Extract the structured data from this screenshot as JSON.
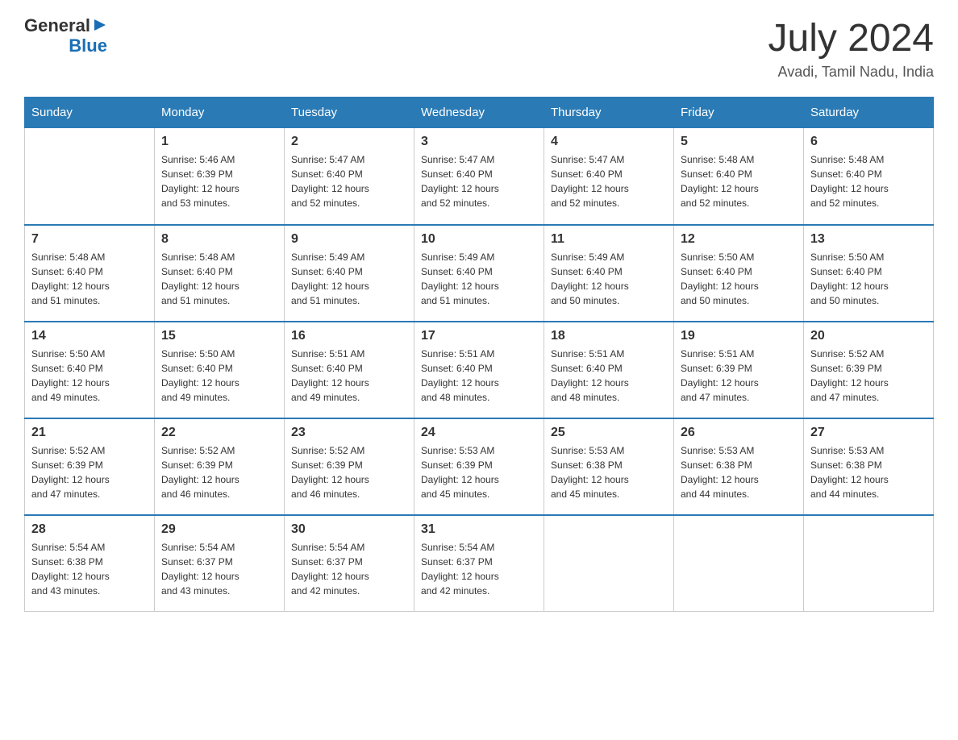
{
  "header": {
    "logo_text": "General",
    "logo_blue": "Blue",
    "month_year": "July 2024",
    "location": "Avadi, Tamil Nadu, India"
  },
  "columns": [
    "Sunday",
    "Monday",
    "Tuesday",
    "Wednesday",
    "Thursday",
    "Friday",
    "Saturday"
  ],
  "weeks": [
    [
      {
        "day": "",
        "info": ""
      },
      {
        "day": "1",
        "info": "Sunrise: 5:46 AM\nSunset: 6:39 PM\nDaylight: 12 hours\nand 53 minutes."
      },
      {
        "day": "2",
        "info": "Sunrise: 5:47 AM\nSunset: 6:40 PM\nDaylight: 12 hours\nand 52 minutes."
      },
      {
        "day": "3",
        "info": "Sunrise: 5:47 AM\nSunset: 6:40 PM\nDaylight: 12 hours\nand 52 minutes."
      },
      {
        "day": "4",
        "info": "Sunrise: 5:47 AM\nSunset: 6:40 PM\nDaylight: 12 hours\nand 52 minutes."
      },
      {
        "day": "5",
        "info": "Sunrise: 5:48 AM\nSunset: 6:40 PM\nDaylight: 12 hours\nand 52 minutes."
      },
      {
        "day": "6",
        "info": "Sunrise: 5:48 AM\nSunset: 6:40 PM\nDaylight: 12 hours\nand 52 minutes."
      }
    ],
    [
      {
        "day": "7",
        "info": "Sunrise: 5:48 AM\nSunset: 6:40 PM\nDaylight: 12 hours\nand 51 minutes."
      },
      {
        "day": "8",
        "info": "Sunrise: 5:48 AM\nSunset: 6:40 PM\nDaylight: 12 hours\nand 51 minutes."
      },
      {
        "day": "9",
        "info": "Sunrise: 5:49 AM\nSunset: 6:40 PM\nDaylight: 12 hours\nand 51 minutes."
      },
      {
        "day": "10",
        "info": "Sunrise: 5:49 AM\nSunset: 6:40 PM\nDaylight: 12 hours\nand 51 minutes."
      },
      {
        "day": "11",
        "info": "Sunrise: 5:49 AM\nSunset: 6:40 PM\nDaylight: 12 hours\nand 50 minutes."
      },
      {
        "day": "12",
        "info": "Sunrise: 5:50 AM\nSunset: 6:40 PM\nDaylight: 12 hours\nand 50 minutes."
      },
      {
        "day": "13",
        "info": "Sunrise: 5:50 AM\nSunset: 6:40 PM\nDaylight: 12 hours\nand 50 minutes."
      }
    ],
    [
      {
        "day": "14",
        "info": "Sunrise: 5:50 AM\nSunset: 6:40 PM\nDaylight: 12 hours\nand 49 minutes."
      },
      {
        "day": "15",
        "info": "Sunrise: 5:50 AM\nSunset: 6:40 PM\nDaylight: 12 hours\nand 49 minutes."
      },
      {
        "day": "16",
        "info": "Sunrise: 5:51 AM\nSunset: 6:40 PM\nDaylight: 12 hours\nand 49 minutes."
      },
      {
        "day": "17",
        "info": "Sunrise: 5:51 AM\nSunset: 6:40 PM\nDaylight: 12 hours\nand 48 minutes."
      },
      {
        "day": "18",
        "info": "Sunrise: 5:51 AM\nSunset: 6:40 PM\nDaylight: 12 hours\nand 48 minutes."
      },
      {
        "day": "19",
        "info": "Sunrise: 5:51 AM\nSunset: 6:39 PM\nDaylight: 12 hours\nand 47 minutes."
      },
      {
        "day": "20",
        "info": "Sunrise: 5:52 AM\nSunset: 6:39 PM\nDaylight: 12 hours\nand 47 minutes."
      }
    ],
    [
      {
        "day": "21",
        "info": "Sunrise: 5:52 AM\nSunset: 6:39 PM\nDaylight: 12 hours\nand 47 minutes."
      },
      {
        "day": "22",
        "info": "Sunrise: 5:52 AM\nSunset: 6:39 PM\nDaylight: 12 hours\nand 46 minutes."
      },
      {
        "day": "23",
        "info": "Sunrise: 5:52 AM\nSunset: 6:39 PM\nDaylight: 12 hours\nand 46 minutes."
      },
      {
        "day": "24",
        "info": "Sunrise: 5:53 AM\nSunset: 6:39 PM\nDaylight: 12 hours\nand 45 minutes."
      },
      {
        "day": "25",
        "info": "Sunrise: 5:53 AM\nSunset: 6:38 PM\nDaylight: 12 hours\nand 45 minutes."
      },
      {
        "day": "26",
        "info": "Sunrise: 5:53 AM\nSunset: 6:38 PM\nDaylight: 12 hours\nand 44 minutes."
      },
      {
        "day": "27",
        "info": "Sunrise: 5:53 AM\nSunset: 6:38 PM\nDaylight: 12 hours\nand 44 minutes."
      }
    ],
    [
      {
        "day": "28",
        "info": "Sunrise: 5:54 AM\nSunset: 6:38 PM\nDaylight: 12 hours\nand 43 minutes."
      },
      {
        "day": "29",
        "info": "Sunrise: 5:54 AM\nSunset: 6:37 PM\nDaylight: 12 hours\nand 43 minutes."
      },
      {
        "day": "30",
        "info": "Sunrise: 5:54 AM\nSunset: 6:37 PM\nDaylight: 12 hours\nand 42 minutes."
      },
      {
        "day": "31",
        "info": "Sunrise: 5:54 AM\nSunset: 6:37 PM\nDaylight: 12 hours\nand 42 minutes."
      },
      {
        "day": "",
        "info": ""
      },
      {
        "day": "",
        "info": ""
      },
      {
        "day": "",
        "info": ""
      }
    ]
  ]
}
